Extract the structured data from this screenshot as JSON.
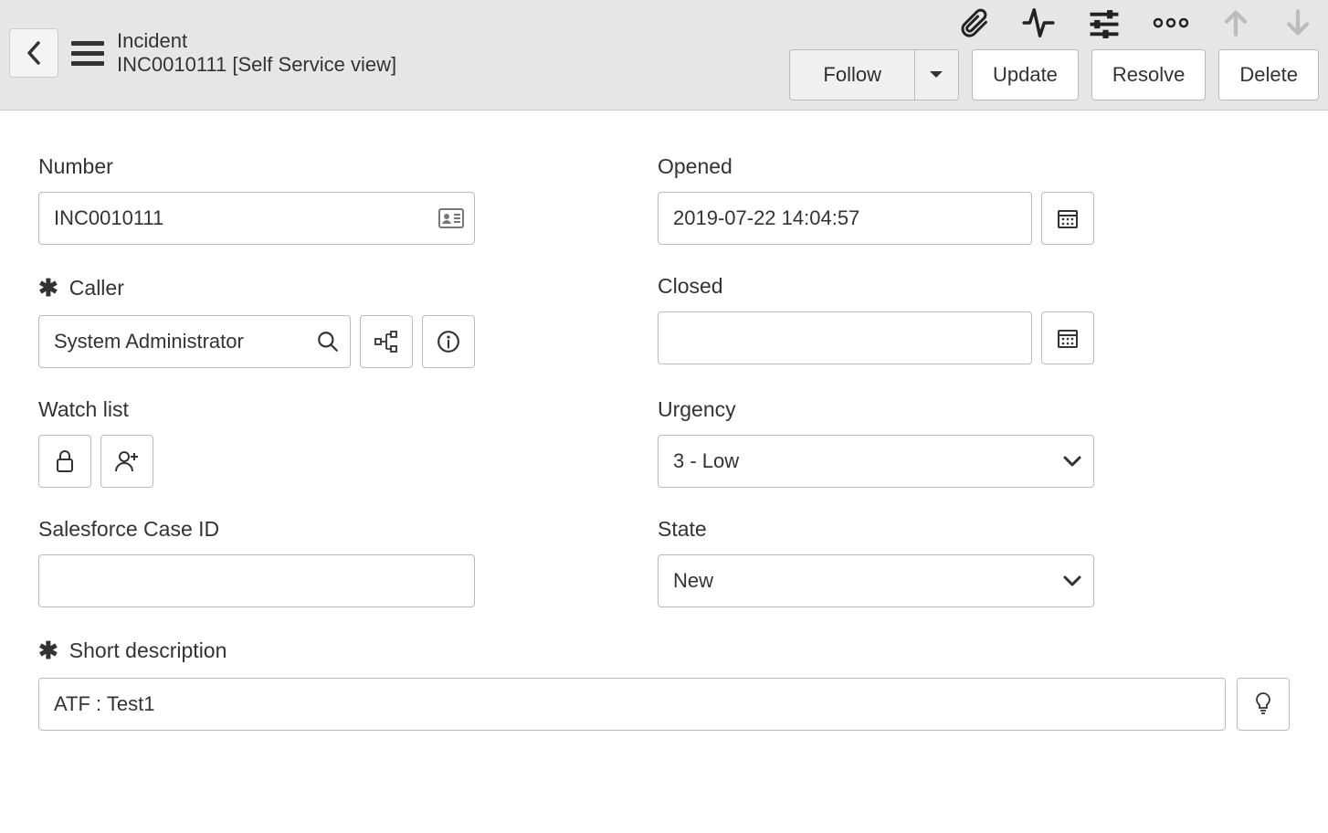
{
  "header": {
    "title": "Incident",
    "subtitle": "INC0010111 [Self Service view]",
    "buttons": {
      "follow": "Follow",
      "update": "Update",
      "resolve": "Resolve",
      "delete": "Delete"
    }
  },
  "form": {
    "number": {
      "label": "Number",
      "value": "INC0010111"
    },
    "opened": {
      "label": "Opened",
      "value": "2019-07-22 14:04:57"
    },
    "caller": {
      "label": "Caller",
      "value": "System Administrator"
    },
    "closed": {
      "label": "Closed",
      "value": ""
    },
    "watch_list": {
      "label": "Watch list"
    },
    "urgency": {
      "label": "Urgency",
      "value": "3 - Low"
    },
    "salesforce": {
      "label": "Salesforce Case ID",
      "value": ""
    },
    "state": {
      "label": "State",
      "value": "New"
    },
    "short_desc": {
      "label": "Short description",
      "value": "ATF : Test1"
    }
  }
}
